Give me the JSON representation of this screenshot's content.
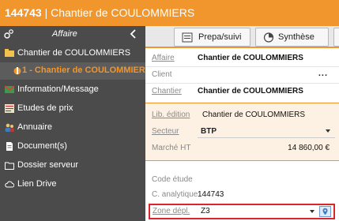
{
  "window": {
    "number": "144743",
    "separator": " | ",
    "name": "Chantier de COULOMMIERS"
  },
  "sidebar": {
    "header": "Affaire",
    "items": [
      {
        "label": "Chantier de COULOMMIERS",
        "icon": "folder-icon"
      },
      {
        "label": "1 - Chantier de COULOMMIERS",
        "icon": "site-icon",
        "selected": true
      },
      {
        "label": "Information/Message",
        "icon": "message-icon"
      },
      {
        "label": "Etudes de prix",
        "icon": "price-study-icon"
      },
      {
        "label": "Annuaire",
        "icon": "contacts-icon"
      },
      {
        "label": "Document(s)",
        "icon": "document-icon"
      },
      {
        "label": "Dossier serveur",
        "icon": "server-folder-icon"
      },
      {
        "label": "Lien Drive",
        "icon": "cloud-icon"
      }
    ]
  },
  "toolbar": {
    "prepa_label": "Prepa/suivi",
    "synthese_label": "Synthèse"
  },
  "form": {
    "affaire_label": "Affaire",
    "affaire_value": "Chantier de COULOMMIERS",
    "client_label": "Client",
    "client_more": "...",
    "chantier_label": "Chantier",
    "chantier_value": "Chantier de COULOMMIERS",
    "lib_edition_label": "Lib. édition",
    "lib_edition_value": "Chantier de COULOMMIERS",
    "secteur_label": "Secteur",
    "secteur_value": "BTP",
    "marche_label": "Marché HT",
    "marche_value": "14 860,00 €",
    "code_etude_label": "Code étude",
    "code_etude_value": "",
    "c_analytique_label": "C. analytique",
    "c_analytique_value": "144743",
    "zone_label": "Zone dépl.",
    "zone_value": "Z3"
  },
  "colors": {
    "accent": "#f0962d",
    "sidebar_bg": "#4b4b4b",
    "highlight_border": "#d9262b"
  }
}
